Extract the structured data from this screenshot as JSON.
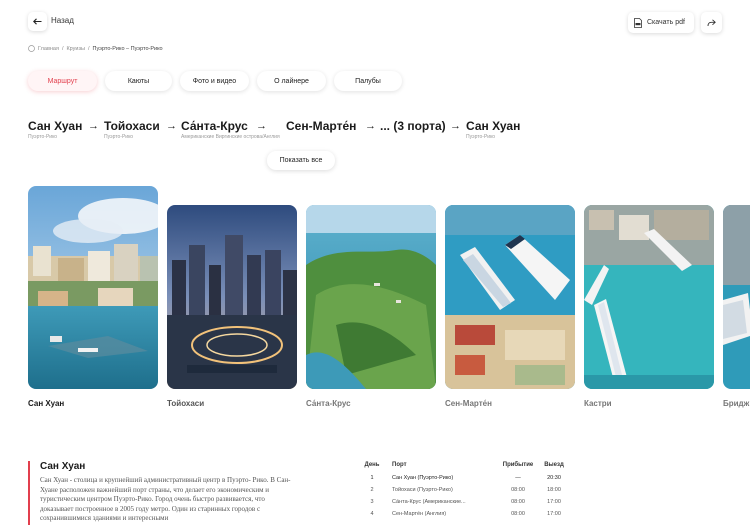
{
  "topbar": {
    "back_label": "Назад",
    "pdf_label": "Скачать pdf"
  },
  "breadcrumbs": [
    "Главная",
    "Круизы",
    "Пуэрто-Рико – Пуэрто-Рико"
  ],
  "tabs": [
    {
      "label": "Маршрут",
      "active": true
    },
    {
      "label": "Каюты",
      "active": false
    },
    {
      "label": "Фото и видео",
      "active": false
    },
    {
      "label": "О лайнере",
      "active": false
    },
    {
      "label": "Палубы",
      "active": false
    }
  ],
  "route": [
    {
      "name": "Сан Хуан",
      "country": "Пуэрто-Рико"
    },
    {
      "name": "Тойохаси",
      "country": "Пуэрто-Рико"
    },
    {
      "name": "Са́нта-Крус",
      "country": "Американские Виргинские острова/Англия"
    },
    {
      "name": "Сен-Марте́н",
      "country": ""
    },
    {
      "name": "... (3 порта)",
      "country": ""
    },
    {
      "name": "Сан Хуан",
      "country": "Пуэрто-Рико"
    }
  ],
  "show_all_label": "Показать все",
  "gallery": [
    {
      "caption": "Сан Хуан",
      "active": true
    },
    {
      "caption": "Тойохаси",
      "active": false
    },
    {
      "caption": "Са́нта-Крус",
      "active": false
    },
    {
      "caption": "Сен-Марте́н",
      "active": false
    },
    {
      "caption": "Кастри",
      "active": false
    },
    {
      "caption": "Бридж",
      "active": false
    }
  ],
  "description": {
    "title": "Сан Хуан",
    "text": "Сан Хуан - столица и крупнейший административный центр в Пуэрто- Рико. В Сан-Хуане расположен важнейший порт страны, что делает его экономическим и туристическим центром Пуэрто-Рико. Город очень быстро развивается, что доказывает построенное в 2005 году метро. Один из старинных городов с сохранившимися зданиями и интересными"
  },
  "schedule": {
    "headers": {
      "day": "День",
      "port": "Порт",
      "arrival": "Прибытие",
      "departure": "Выезд"
    },
    "rows": [
      {
        "day": "1",
        "port": "Сан Хуан (Пуэрто-Рико)",
        "arrival": "—",
        "departure": "20:30"
      },
      {
        "day": "2",
        "port": "Тойохаси (Пуэрто-Рико)",
        "arrival": "08:00",
        "departure": "18:00"
      },
      {
        "day": "3",
        "port": "Са́нта-Крус (Американские...",
        "arrival": "08:00",
        "departure": "17:00"
      },
      {
        "day": "4",
        "port": "Сен-Марте́н (Англия)",
        "arrival": "08:00",
        "departure": "17:00"
      }
    ]
  },
  "colors": {
    "accent": "#e23f4d",
    "text": "#1b1b1b",
    "muted": "#9a9a9a"
  }
}
